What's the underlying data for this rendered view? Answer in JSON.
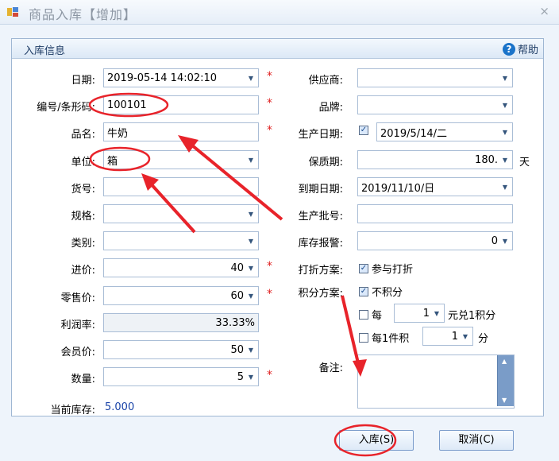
{
  "window": {
    "title": "商品入库【增加】",
    "close": "×"
  },
  "panel": {
    "title": "入库信息",
    "help": "帮助"
  },
  "left": {
    "date": {
      "label": "日期:",
      "value": "2019-05-14 14:02:10"
    },
    "code": {
      "label": "编号/条形码:",
      "value": "100101"
    },
    "name": {
      "label": "品名:",
      "value": "牛奶"
    },
    "unit": {
      "label": "单位:",
      "value": "箱"
    },
    "itemno": {
      "label": "货号:",
      "value": ""
    },
    "spec": {
      "label": "规格:",
      "value": ""
    },
    "category": {
      "label": "类别:",
      "value": ""
    },
    "cost": {
      "label": "进价:",
      "value": "40"
    },
    "retail": {
      "label": "零售价:",
      "value": "60"
    },
    "margin": {
      "label": "利润率:",
      "value": "33.33%"
    },
    "member": {
      "label": "会员价:",
      "value": "50"
    },
    "qty": {
      "label": "数量:",
      "value": "5"
    },
    "stock": {
      "label": "当前库存:",
      "value": "5.000"
    }
  },
  "right": {
    "supplier": {
      "label": "供应商:",
      "value": ""
    },
    "brand": {
      "label": "品牌:",
      "value": ""
    },
    "mfg": {
      "label": "生产日期:",
      "value": "2019/5/14/二",
      "checked": true
    },
    "shelf": {
      "label": "保质期:",
      "value": "180.",
      "unit": "天"
    },
    "expiry": {
      "label": "到期日期:",
      "value": "2019/11/10/日"
    },
    "batch": {
      "label": "生产批号:",
      "value": ""
    },
    "alert": {
      "label": "库存报警:",
      "value": "0"
    },
    "discount": {
      "label": "打折方案:",
      "option": "参与打折",
      "checked": true
    },
    "points": {
      "label": "积分方案:",
      "option": "不积分",
      "checked": true
    },
    "per_yuan": {
      "prefix": "每",
      "value": "1",
      "suffix": "元兑1积分",
      "checked": false
    },
    "per_item": {
      "prefix": "每1件积",
      "value": "1",
      "suffix": "分",
      "checked": false
    },
    "memo": {
      "label": "备注:"
    }
  },
  "buttons": {
    "save": "入库(S)",
    "cancel": "取消(C)"
  },
  "colors": {
    "required": "#e02020",
    "annotation": "#e8232a",
    "stock": "#1a44a8"
  },
  "required_mark": "*"
}
